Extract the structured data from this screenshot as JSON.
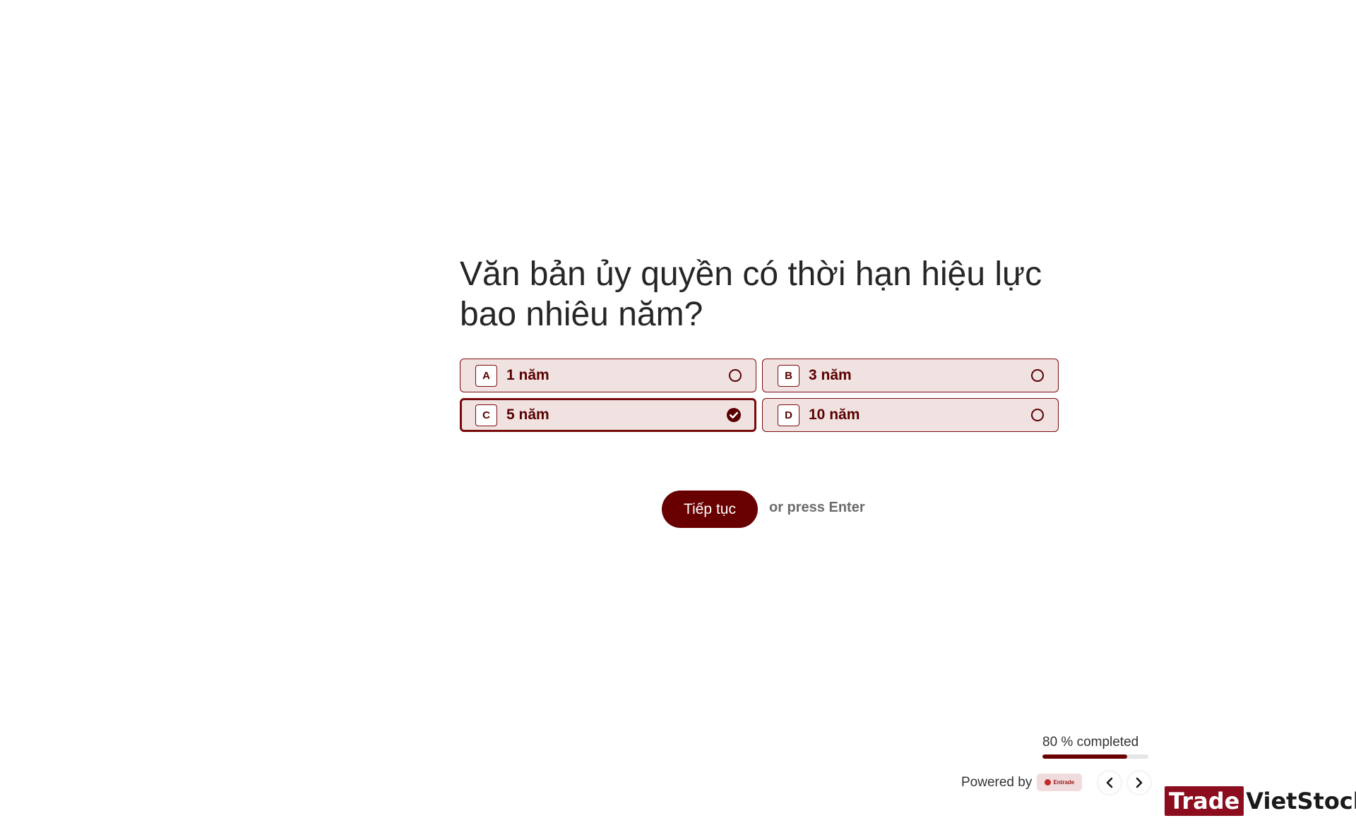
{
  "question": {
    "text": "Văn bản ủy quyền có thời hạn hiệu lực bao nhiêu năm?"
  },
  "choices": [
    {
      "key": "A",
      "label": "1 năm",
      "selected": false
    },
    {
      "key": "B",
      "label": "3 năm",
      "selected": false
    },
    {
      "key": "C",
      "label": "5 năm",
      "selected": true
    },
    {
      "key": "D",
      "label": "10 năm",
      "selected": false
    }
  ],
  "actions": {
    "continue_label": "Tiếp tục",
    "hint": "or press Enter"
  },
  "progress": {
    "text": "80 % completed",
    "fraction": 0.8
  },
  "footer": {
    "powered_by": "Powered by",
    "brand_text": "Entrade"
  },
  "watermark": {
    "part1": "Trade",
    "part2": "VietStock"
  },
  "colors": {
    "accent": "#690000",
    "choice_bg": "#f1e2e2",
    "choice_border": "#7a0b0b"
  },
  "icons": {
    "unselected": "radio-empty-icon",
    "selected": "check-circle-icon",
    "prev": "chevron-left-icon",
    "next": "chevron-right-icon"
  }
}
